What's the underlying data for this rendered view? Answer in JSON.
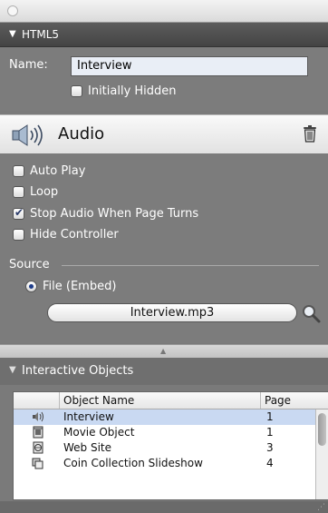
{
  "section": {
    "title": "HTML5"
  },
  "name_field": {
    "label": "Name:",
    "value": "Interview"
  },
  "initially_hidden": {
    "label": "Initially Hidden",
    "checked": false
  },
  "object_type": {
    "label": "Audio"
  },
  "options": [
    {
      "label": "Auto Play",
      "checked": false
    },
    {
      "label": "Loop",
      "checked": false
    },
    {
      "label": "Stop Audio When Page Turns",
      "checked": true
    },
    {
      "label": "Hide Controller",
      "checked": false
    }
  ],
  "source": {
    "label": "Source",
    "option_label": "File (Embed)",
    "selected": true,
    "file_name": "Interview.mp3"
  },
  "interactive_objects": {
    "title": "Interactive Objects",
    "columns": {
      "name": "Object Name",
      "page": "Page"
    },
    "rows": [
      {
        "icon": "audio-icon",
        "name": "Interview",
        "page": "1",
        "selected": true
      },
      {
        "icon": "movie-icon",
        "name": "Movie Object",
        "page": "1",
        "selected": false
      },
      {
        "icon": "web-icon",
        "name": "Web Site",
        "page": "3",
        "selected": false
      },
      {
        "icon": "slideshow-icon",
        "name": "Coin Collection Slideshow",
        "page": "4",
        "selected": false
      }
    ]
  },
  "colors": {
    "panel_bg": "#7c7c7c",
    "header_bg": "#444444",
    "selection": "#c9d9f2",
    "radio_dot": "#1d3c8a"
  }
}
